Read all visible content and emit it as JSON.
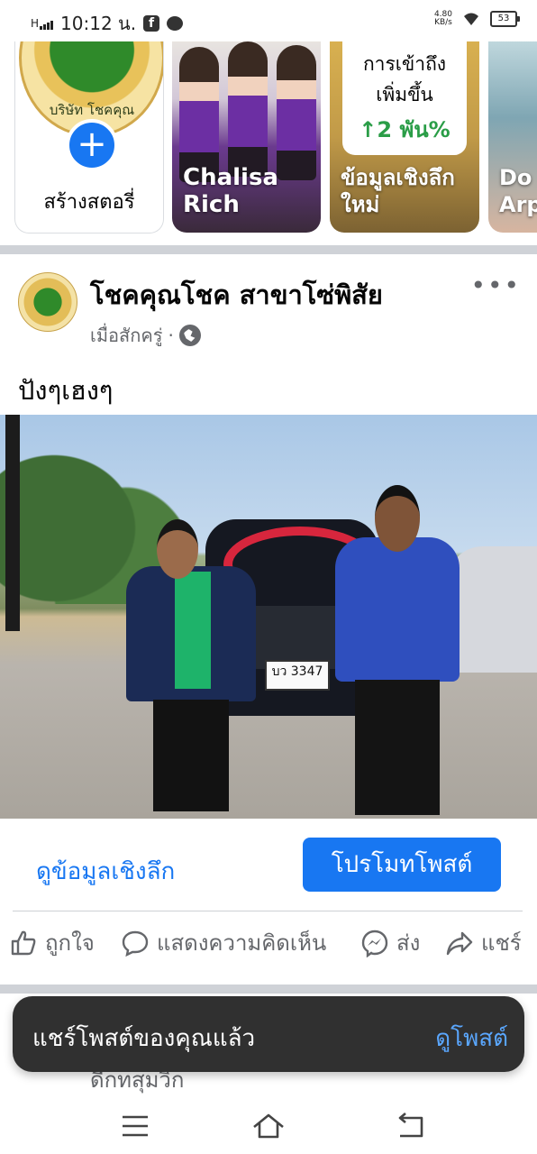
{
  "status_bar": {
    "signal": "H",
    "time": "10:12 น.",
    "net_speed_value": "4.80",
    "net_speed_unit": "KB/s",
    "battery": "53",
    "app_icons": [
      "facebook-icon",
      "line-icon"
    ]
  },
  "stories": {
    "create_label": "สร้างสตอรี่",
    "create_logo_text": "บริษัท โชคคุณโชค",
    "items": [
      {
        "name": "Chalisa Rich"
      },
      {
        "name": "ข้อมูลเชิงลึกใหม่"
      },
      {
        "name": "Do Arp"
      }
    ],
    "insight_card": {
      "line1": "การเข้าถึง",
      "line2": "เพิ่มขึ้น",
      "value": "↑2 พัน%"
    }
  },
  "post": {
    "author": "โชคคุณโชค สาขาโซ่พิสัย",
    "time": "เมื่อสักครู่",
    "text": "ปังๆเฮงๆ",
    "more_icon": "more-dots-icon",
    "photo_plate": "บว 3347",
    "insights_label": "ดูข้อมูลเชิงลึก",
    "promote_label": "โปรโมทโพสต์"
  },
  "actions": {
    "like": "ถูกใจ",
    "comment": "แสดงความคิดเห็น",
    "send": "ส่ง",
    "share": "แชร์"
  },
  "toast": {
    "message": "แชร์โพสต์ของคุณแล้ว",
    "action": "ดูโพสต์",
    "behind_text": "ดีกทสุมวิก"
  },
  "colors": {
    "brand_blue": "#1877f2",
    "toast_bg": "#303030",
    "success_green": "#2a9d47"
  }
}
